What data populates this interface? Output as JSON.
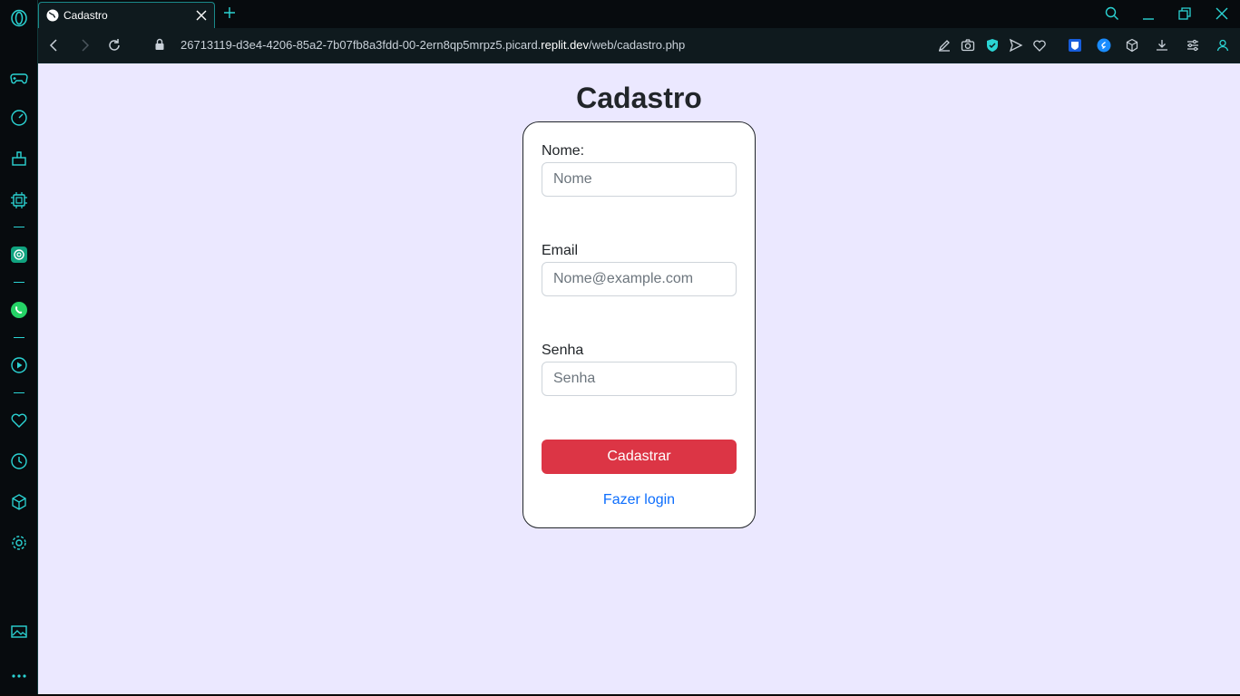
{
  "browser": {
    "tab_title": "Cadastro",
    "url_prefix": "26713119-d3e4-4206-85a2-7b07fb8a3fdd-00-2ern8qp5mrpz5.picard.",
    "url_host": "replit.dev",
    "url_path": "/web/cadastro.php",
    "accent_color": "#2bd4d4"
  },
  "page": {
    "title": "Cadastro",
    "background": "#ebe8ff"
  },
  "form": {
    "nome_label": "Nome:",
    "nome_placeholder": "Nome",
    "email_label": "Email",
    "email_placeholder": "Nome@example.com",
    "senha_label": "Senha",
    "senha_placeholder": "Senha",
    "submit_label": "Cadastrar",
    "submit_color": "#dc3545",
    "login_link": "Fazer login",
    "link_color": "#0d6efd"
  }
}
